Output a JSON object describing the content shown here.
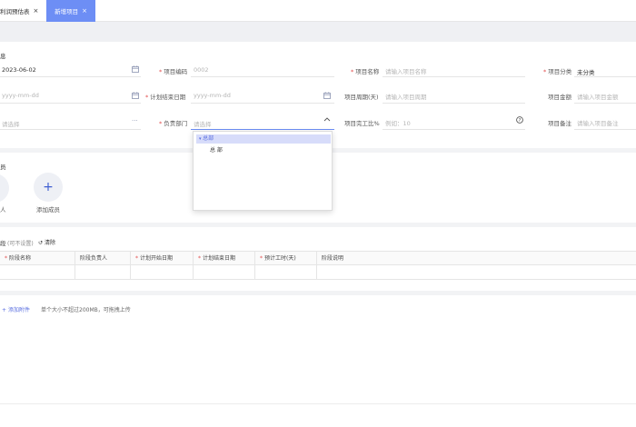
{
  "tabs": [
    {
      "label": "利润预估表",
      "close": "×"
    },
    {
      "label": "新增项目",
      "close": "×"
    }
  ],
  "basic": {
    "section_title": "息",
    "row1": {
      "start_date_value": "2023-06-02",
      "project_code_label": "项目编码",
      "project_code_value": "0002",
      "project_name_label": "项目名称",
      "project_name_placeholder": "请输入项目名称",
      "category_label": "项目分类",
      "category_value": "未分类"
    },
    "row2": {
      "date_placeholder": "yyyy-mm-dd",
      "plan_end_label": "计划结束日期",
      "plan_end_placeholder": "yyyy-mm-dd",
      "period_label": "项目周期(天)",
      "period_placeholder": "请输入项目周期",
      "amount_label": "项目金额",
      "amount_placeholder": "请输入项目金额"
    },
    "row3": {
      "select_placeholder": "请选择",
      "dept_label": "负责部门",
      "dept_placeholder": "请选择",
      "completion_label": "项目完工比%",
      "completion_placeholder": "例如：10",
      "remark_label": "项目备注",
      "remark_placeholder": "请输入项目备注"
    }
  },
  "dropdown": {
    "root_label": "总部",
    "child_label": "总 部"
  },
  "members": {
    "section_title": "员",
    "partial_label": "人",
    "add_label": "添加成员",
    "add_icon": "+"
  },
  "stages": {
    "section_title": "段",
    "hint": "(可不设置)",
    "clear_label": "清除",
    "columns": [
      "阶段名称",
      "阶段负责人",
      "计划开始日期",
      "计划结束日期",
      "预计工时(天)",
      "阶段说明"
    ]
  },
  "attachment": {
    "add_label": "添加附件",
    "hint": "单个大小不超过200MB，可拖拽上传"
  },
  "colors": {
    "accent": "#6d8ef5",
    "required": "#e34d4d",
    "placeholder": "#b5b5b5"
  }
}
